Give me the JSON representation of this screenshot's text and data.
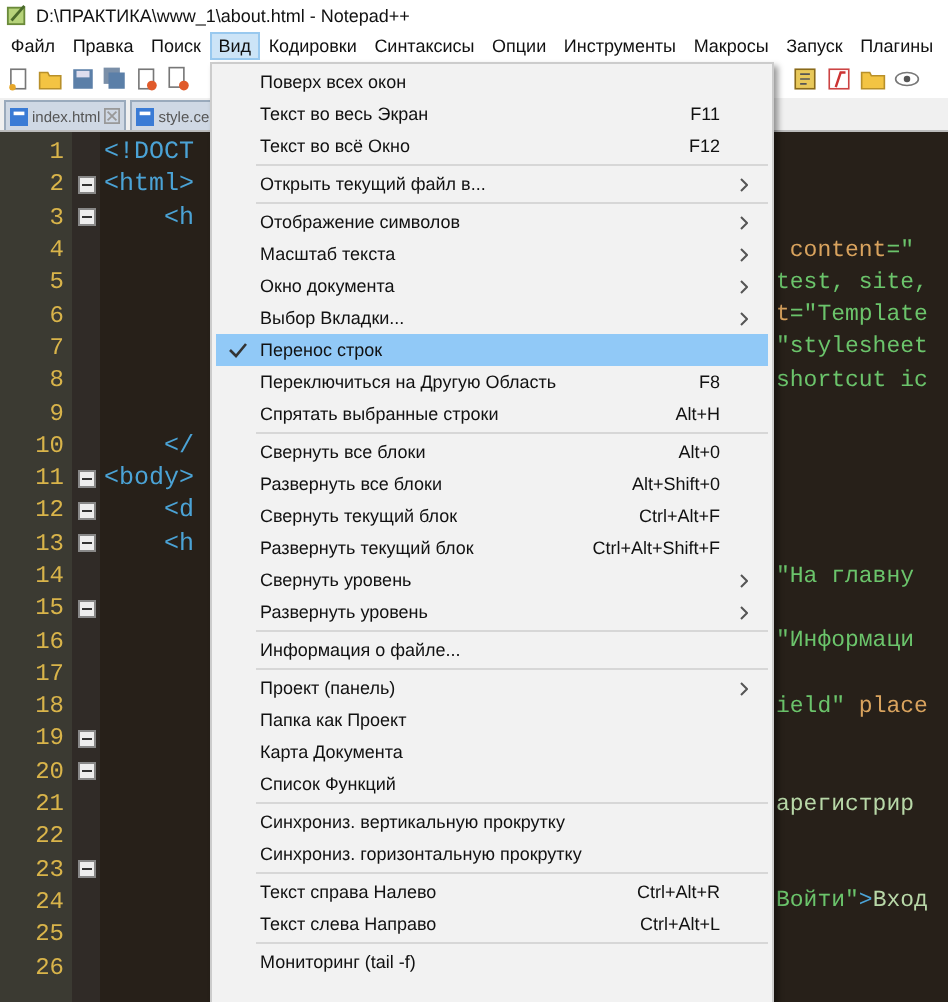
{
  "window": {
    "title": "D:\\ПРАКТИКА\\www_1\\about.html - Notepad++"
  },
  "menubar": [
    {
      "label": "Файл",
      "selected": false
    },
    {
      "label": "Правка",
      "selected": false
    },
    {
      "label": "Поиск",
      "selected": false
    },
    {
      "label": "Вид",
      "selected": true
    },
    {
      "label": "Кодировки",
      "selected": false
    },
    {
      "label": "Синтаксисы",
      "selected": false
    },
    {
      "label": "Опции",
      "selected": false
    },
    {
      "label": "Инструменты",
      "selected": false
    },
    {
      "label": "Макросы",
      "selected": false
    },
    {
      "label": "Запуск",
      "selected": false
    },
    {
      "label": "Плагины",
      "selected": false
    }
  ],
  "tabs": [
    {
      "label": "index.html"
    },
    {
      "label": "style.ce"
    }
  ],
  "editor": {
    "lines": [
      {
        "number": "1",
        "left": [
          {
            "text": "<!DOCT",
            "kind": "tag"
          }
        ]
      },
      {
        "number": "2",
        "fold": true,
        "left": [
          {
            "text": "<html>",
            "kind": "tag"
          }
        ]
      },
      {
        "number": "3",
        "fold": true,
        "left": [
          {
            "text": "    <h",
            "kind": "tag"
          }
        ]
      },
      {
        "number": "4",
        "right": [
          {
            "text": " content",
            "kind": "attr"
          },
          {
            "text": "=\"",
            "kind": "string"
          }
        ]
      },
      {
        "number": "5",
        "right": [
          {
            "text": "test, site,",
            "kind": "string"
          }
        ]
      },
      {
        "number": "6",
        "right": [
          {
            "text": "t",
            "kind": "attr"
          },
          {
            "text": "=\"Template",
            "kind": "string"
          }
        ]
      },
      {
        "number": "7",
        "right": [
          {
            "text": "\"stylesheet",
            "kind": "string"
          }
        ]
      },
      {
        "number": "8",
        "right": [
          {
            "text": "shortcut ic",
            "kind": "string"
          }
        ]
      },
      {
        "number": "9"
      },
      {
        "number": "10",
        "left": [
          {
            "text": "    </",
            "kind": "tag"
          }
        ]
      },
      {
        "number": "11",
        "fold": true,
        "left": [
          {
            "text": "<body>",
            "kind": "tag"
          }
        ]
      },
      {
        "number": "12",
        "fold": true,
        "left": [
          {
            "text": "    <d",
            "kind": "tag"
          }
        ]
      },
      {
        "number": "13",
        "fold": true,
        "left": [
          {
            "text": "    <h",
            "kind": "tag"
          }
        ]
      },
      {
        "number": "14",
        "right": [
          {
            "text": "\"На главну",
            "kind": "string"
          }
        ]
      },
      {
        "number": "15",
        "fold": true
      },
      {
        "number": "16",
        "right": [
          {
            "text": "\"Информаци",
            "kind": "string"
          }
        ]
      },
      {
        "number": "17"
      },
      {
        "number": "18",
        "right": [
          {
            "text": "ield\"",
            "kind": "string"
          },
          {
            "text": " place",
            "kind": "attr"
          }
        ]
      },
      {
        "number": "19",
        "fold": true
      },
      {
        "number": "20",
        "fold": true
      },
      {
        "number": "21",
        "right": [
          {
            "text": "арегистрир",
            "kind": "text"
          }
        ]
      },
      {
        "number": "22"
      },
      {
        "number": "23",
        "fold": true
      },
      {
        "number": "24",
        "right": [
          {
            "text": "Войти\"",
            "kind": "string"
          },
          {
            "text": ">",
            "kind": "tag"
          },
          {
            "text": "Вход",
            "kind": "text"
          }
        ]
      },
      {
        "number": "25"
      },
      {
        "number": "26"
      }
    ]
  },
  "menu": {
    "items": [
      {
        "kind": "item",
        "label": "Поверх всех окон",
        "checked": false,
        "selected": false
      },
      {
        "kind": "item",
        "label": "Текст во весь Экран",
        "shortcut": "F11",
        "checked": false,
        "selected": false
      },
      {
        "kind": "item",
        "label": "Текст во всё Окно",
        "shortcut": "F12",
        "checked": false,
        "selected": false
      },
      {
        "kind": "separator"
      },
      {
        "kind": "submenu",
        "label": "Открыть текущий файл в...",
        "checked": false,
        "selected": false
      },
      {
        "kind": "separator"
      },
      {
        "kind": "submenu",
        "label": "Отображение символов",
        "checked": false,
        "selected": false
      },
      {
        "kind": "submenu",
        "label": "Масштаб текста",
        "checked": false,
        "selected": false
      },
      {
        "kind": "submenu",
        "label": "Окно документа",
        "checked": false,
        "selected": false
      },
      {
        "kind": "submenu",
        "label": "Выбор Вкладки...",
        "checked": false,
        "selected": false
      },
      {
        "kind": "item",
        "label": "Перенос строк",
        "checked": true,
        "selected": true
      },
      {
        "kind": "item",
        "label": "Переключиться на Другую Область",
        "shortcut": "F8",
        "checked": false,
        "selected": false
      },
      {
        "kind": "item",
        "label": "Спрятать выбранные строки",
        "shortcut": "Alt+H",
        "checked": false,
        "selected": false
      },
      {
        "kind": "separator"
      },
      {
        "kind": "item",
        "label": "Свернуть все блоки",
        "shortcut": "Alt+0",
        "checked": false,
        "selected": false
      },
      {
        "kind": "item",
        "label": "Развернуть все блоки",
        "shortcut": "Alt+Shift+0",
        "checked": false,
        "selected": false
      },
      {
        "kind": "item",
        "label": "Свернуть текущий блок",
        "shortcut": "Ctrl+Alt+F",
        "checked": false,
        "selected": false
      },
      {
        "kind": "item",
        "label": "Развернуть текущий блок",
        "shortcut": "Ctrl+Alt+Shift+F",
        "checked": false,
        "selected": false
      },
      {
        "kind": "submenu",
        "label": "Свернуть уровень",
        "checked": false,
        "selected": false
      },
      {
        "kind": "submenu",
        "label": "Развернуть уровень",
        "checked": false,
        "selected": false
      },
      {
        "kind": "separator"
      },
      {
        "kind": "item",
        "label": "Информация о файле...",
        "checked": false,
        "selected": false
      },
      {
        "kind": "separator"
      },
      {
        "kind": "submenu",
        "label": "Проект (панель)",
        "checked": false,
        "selected": false
      },
      {
        "kind": "item",
        "label": "Папка как Проект",
        "checked": false,
        "selected": false
      },
      {
        "kind": "item",
        "label": "Карта Документа",
        "checked": false,
        "selected": false
      },
      {
        "kind": "item",
        "label": "Список Функций",
        "checked": false,
        "selected": false
      },
      {
        "kind": "separator"
      },
      {
        "kind": "item",
        "label": "Синхрониз. вертикальную прокрутку",
        "checked": false,
        "selected": false
      },
      {
        "kind": "item",
        "label": "Синхрониз. горизонтальную прокрутку",
        "checked": false,
        "selected": false
      },
      {
        "kind": "separator"
      },
      {
        "kind": "item",
        "label": "Текст справа Налево",
        "shortcut": "Ctrl+Alt+R",
        "checked": false,
        "selected": false
      },
      {
        "kind": "item",
        "label": "Текст слева Направо",
        "shortcut": "Ctrl+Alt+L",
        "checked": false,
        "selected": false
      },
      {
        "kind": "separator"
      },
      {
        "kind": "item",
        "label": "Мониторинг (tail -f)",
        "checked": false,
        "selected": false
      }
    ]
  }
}
